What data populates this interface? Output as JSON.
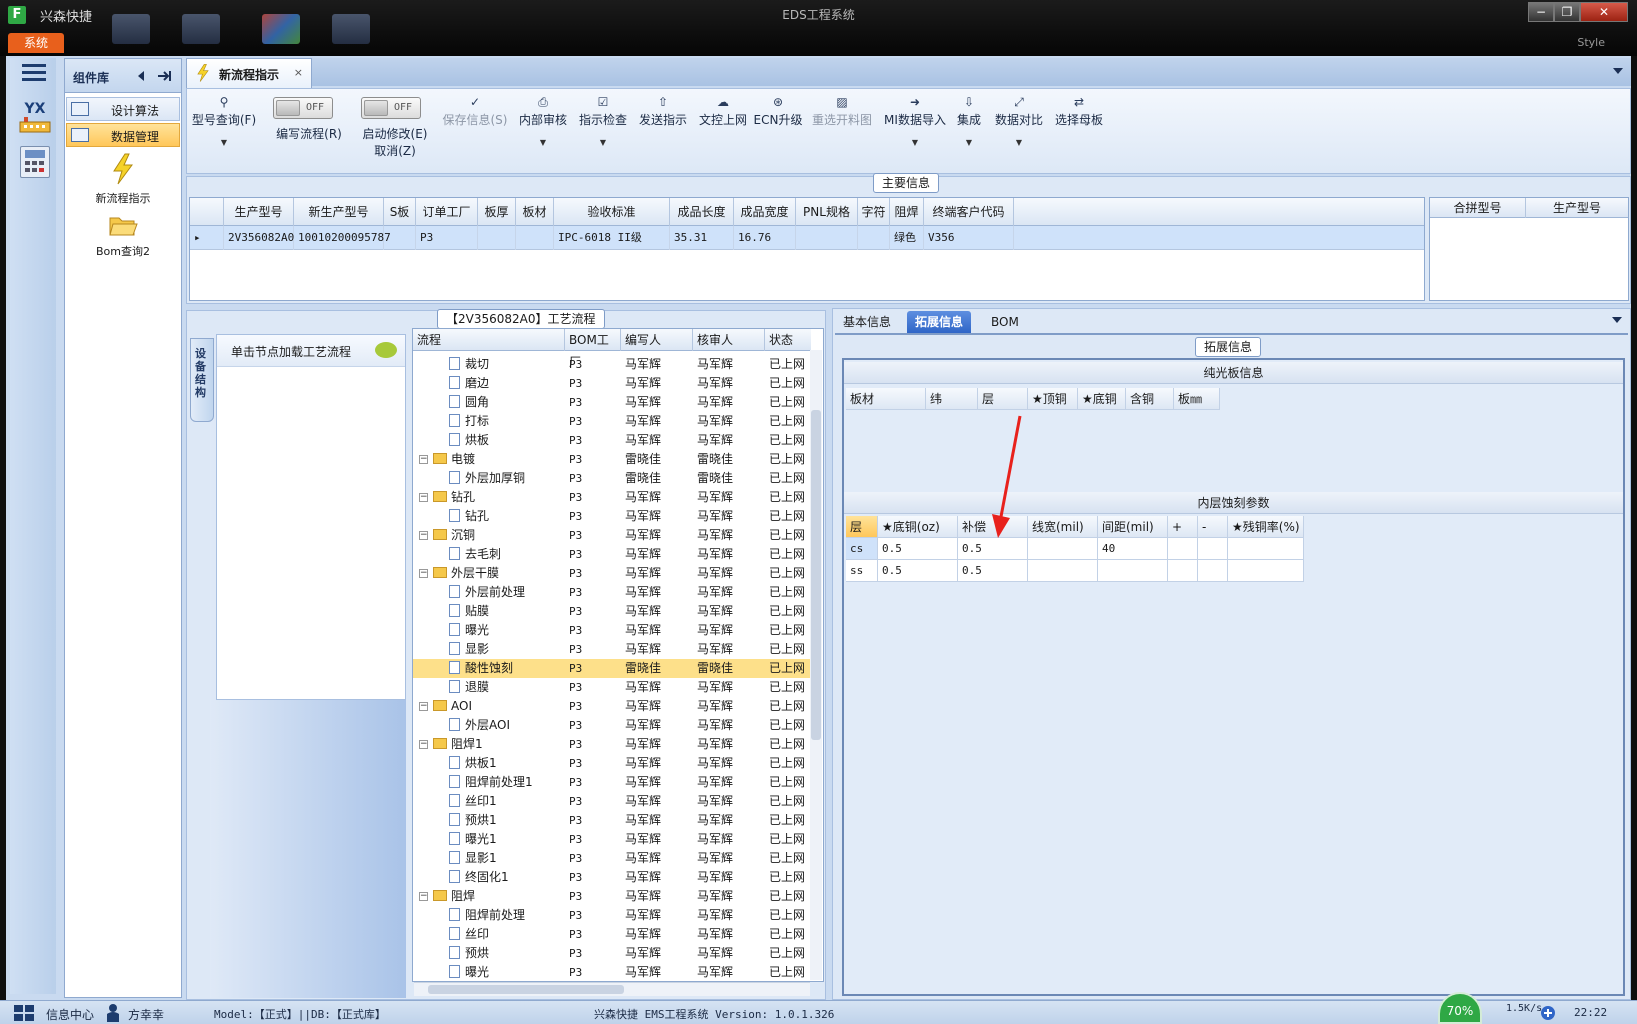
{
  "app": {
    "name": "兴森快捷",
    "window_title": "EDS工程系统",
    "system_menu": "系统",
    "style_label": "Style"
  },
  "window_buttons": {
    "minimize": "−",
    "restore": "❐",
    "close": "✕"
  },
  "library": {
    "title": "组件库",
    "items": [
      {
        "label": "设计算法",
        "selected": false
      },
      {
        "label": "数据管理",
        "selected": true
      }
    ],
    "big_items": [
      {
        "label": "新流程指示"
      },
      {
        "label": "Bom查询2"
      }
    ]
  },
  "doc_tab": {
    "label": "新流程指示",
    "close": "×"
  },
  "ribbon": {
    "buttons": [
      {
        "label": "型号查询(F)",
        "icon": "search-icon",
        "enabled": true
      },
      {
        "label": "编写流程(R)",
        "toggle": "OFF"
      },
      {
        "label": "启动修改(E)",
        "sub": "取消(Z)",
        "toggle": "OFF"
      },
      {
        "label": "保存信息(S)",
        "icon": "check-icon",
        "enabled": false
      },
      {
        "label": "内部审核",
        "icon": "printer-icon",
        "enabled": true
      },
      {
        "label": "指示检查",
        "icon": "checkbox-icon",
        "enabled": true
      },
      {
        "label": "发送指示",
        "icon": "upload-icon",
        "enabled": true
      },
      {
        "label": "文控上网",
        "icon": "cloud-upload-icon",
        "enabled": true
      },
      {
        "label": "ECN升级",
        "icon": "binoculars-icon",
        "enabled": true
      },
      {
        "label": "重选开料图",
        "icon": "image-icon",
        "enabled": false
      },
      {
        "label": "MI数据导入",
        "icon": "import-icon",
        "enabled": true
      },
      {
        "label": "集成",
        "icon": "download-icon",
        "enabled": true
      },
      {
        "label": "数据对比",
        "icon": "compare-icon",
        "enabled": true
      },
      {
        "label": "选择母板",
        "icon": "shuffle-icon",
        "enabled": true
      }
    ]
  },
  "main_info": {
    "title": "主要信息",
    "columns": [
      "生产型号",
      "新生产型号",
      "S板",
      "订单工厂",
      "板厚",
      "板材",
      "验收标准",
      "成品长度",
      "成品宽度",
      "PNL规格",
      "字符",
      "阻焊",
      "终端客户代码"
    ],
    "row": [
      "2V356082A0",
      "10010200095787",
      "",
      "P3",
      "",
      "",
      "IPC-6018 II级",
      "35.31",
      "16.76",
      "",
      "",
      "绿色",
      "V356"
    ],
    "side_columns": [
      "合拼型号",
      "生产型号"
    ]
  },
  "process": {
    "title": "【2V356082A0】工艺流程",
    "side_tab": "设备结构",
    "node_hint": "单击节点加载工艺流程",
    "columns": [
      "流程",
      "BOM工厂",
      "编写人",
      "核审人",
      "状态"
    ],
    "rows": [
      {
        "name": "裁切",
        "level": 2,
        "factory": "P3",
        "writer": "马军辉",
        "reviewer": "马军辉",
        "status": "已上网"
      },
      {
        "name": "磨边",
        "level": 2,
        "factory": "P3",
        "writer": "马军辉",
        "reviewer": "马军辉",
        "status": "已上网"
      },
      {
        "name": "圆角",
        "level": 2,
        "factory": "P3",
        "writer": "马军辉",
        "reviewer": "马军辉",
        "status": "已上网"
      },
      {
        "name": "打标",
        "level": 2,
        "factory": "P3",
        "writer": "马军辉",
        "reviewer": "马军辉",
        "status": "已上网"
      },
      {
        "name": "烘板",
        "level": 2,
        "factory": "P3",
        "writer": "马军辉",
        "reviewer": "马军辉",
        "status": "已上网"
      },
      {
        "name": "电镀",
        "level": 1,
        "factory": "P3",
        "writer": "雷晓佳",
        "reviewer": "雷晓佳",
        "status": "已上网"
      },
      {
        "name": "外层加厚铜",
        "level": 2,
        "factory": "P3",
        "writer": "雷晓佳",
        "reviewer": "雷晓佳",
        "status": "已上网"
      },
      {
        "name": "钻孔",
        "level": 1,
        "factory": "P3",
        "writer": "马军辉",
        "reviewer": "马军辉",
        "status": "已上网"
      },
      {
        "name": "钻孔",
        "level": 2,
        "factory": "P3",
        "writer": "马军辉",
        "reviewer": "马军辉",
        "status": "已上网"
      },
      {
        "name": "沉铜",
        "level": 1,
        "factory": "P3",
        "writer": "马军辉",
        "reviewer": "马军辉",
        "status": "已上网"
      },
      {
        "name": "去毛刺",
        "level": 2,
        "factory": "P3",
        "writer": "马军辉",
        "reviewer": "马军辉",
        "status": "已上网"
      },
      {
        "name": "外层干膜",
        "level": 1,
        "factory": "P3",
        "writer": "马军辉",
        "reviewer": "马军辉",
        "status": "已上网"
      },
      {
        "name": "外层前处理",
        "level": 2,
        "factory": "P3",
        "writer": "马军辉",
        "reviewer": "马军辉",
        "status": "已上网"
      },
      {
        "name": "贴膜",
        "level": 2,
        "factory": "P3",
        "writer": "马军辉",
        "reviewer": "马军辉",
        "status": "已上网"
      },
      {
        "name": "曝光",
        "level": 2,
        "factory": "P3",
        "writer": "马军辉",
        "reviewer": "马军辉",
        "status": "已上网"
      },
      {
        "name": "显影",
        "level": 2,
        "factory": "P3",
        "writer": "马军辉",
        "reviewer": "马军辉",
        "status": "已上网"
      },
      {
        "name": "酸性蚀刻",
        "level": 2,
        "factory": "P3",
        "writer": "雷晓佳",
        "reviewer": "雷晓佳",
        "status": "已上网",
        "selected": true
      },
      {
        "name": "退膜",
        "level": 2,
        "factory": "P3",
        "writer": "马军辉",
        "reviewer": "马军辉",
        "status": "已上网"
      },
      {
        "name": "AOI",
        "level": 1,
        "factory": "P3",
        "writer": "马军辉",
        "reviewer": "马军辉",
        "status": "已上网"
      },
      {
        "name": "外层AOI",
        "level": 2,
        "factory": "P3",
        "writer": "马军辉",
        "reviewer": "马军辉",
        "status": "已上网"
      },
      {
        "name": "阻焊1",
        "level": 1,
        "factory": "P3",
        "writer": "马军辉",
        "reviewer": "马军辉",
        "status": "已上网"
      },
      {
        "name": "烘板1",
        "level": 2,
        "factory": "P3",
        "writer": "马军辉",
        "reviewer": "马军辉",
        "status": "已上网"
      },
      {
        "name": "阻焊前处理1",
        "level": 2,
        "factory": "P3",
        "writer": "马军辉",
        "reviewer": "马军辉",
        "status": "已上网"
      },
      {
        "name": "丝印1",
        "level": 2,
        "factory": "P3",
        "writer": "马军辉",
        "reviewer": "马军辉",
        "status": "已上网"
      },
      {
        "name": "预烘1",
        "level": 2,
        "factory": "P3",
        "writer": "马军辉",
        "reviewer": "马军辉",
        "status": "已上网"
      },
      {
        "name": "曝光1",
        "level": 2,
        "factory": "P3",
        "writer": "马军辉",
        "reviewer": "马军辉",
        "status": "已上网"
      },
      {
        "name": "显影1",
        "level": 2,
        "factory": "P3",
        "writer": "马军辉",
        "reviewer": "马军辉",
        "status": "已上网"
      },
      {
        "name": "终固化1",
        "level": 2,
        "factory": "P3",
        "writer": "马军辉",
        "reviewer": "马军辉",
        "status": "已上网"
      },
      {
        "name": "阻焊",
        "level": 1,
        "factory": "P3",
        "writer": "马军辉",
        "reviewer": "马军辉",
        "status": "已上网"
      },
      {
        "name": "阻焊前处理",
        "level": 2,
        "factory": "P3",
        "writer": "马军辉",
        "reviewer": "马军辉",
        "status": "已上网"
      },
      {
        "name": "丝印",
        "level": 2,
        "factory": "P3",
        "writer": "马军辉",
        "reviewer": "马军辉",
        "status": "已上网"
      },
      {
        "name": "预烘",
        "level": 2,
        "factory": "P3",
        "writer": "马军辉",
        "reviewer": "马军辉",
        "status": "已上网"
      },
      {
        "name": "曝光",
        "level": 2,
        "factory": "P3",
        "writer": "马军辉",
        "reviewer": "马军辉",
        "status": "已上网"
      }
    ]
  },
  "right": {
    "tabs": [
      {
        "label": "基本信息"
      },
      {
        "label": "拓展信息",
        "selected": true
      },
      {
        "label": "BOM"
      }
    ],
    "group_title": "拓展信息",
    "bare_board": {
      "title": "纯光板信息",
      "columns": [
        "板材",
        "纬",
        "层",
        "★顶铜",
        "★底铜",
        "含铜",
        "板㎜"
      ]
    },
    "inner_etch": {
      "title": "内层蚀刻参数",
      "columns": [
        "层",
        "★底铜(oz)",
        "补偿",
        "线宽(mil)",
        "间距(mil)",
        "+",
        "-",
        "★残铜率(%)"
      ],
      "rows": [
        [
          "cs",
          "0.5",
          "0.5",
          "",
          "40",
          "",
          "",
          ""
        ],
        [
          "ss",
          "0.5",
          "0.5",
          "",
          "",
          "",
          "",
          ""
        ]
      ]
    }
  },
  "status": {
    "info_center": "信息中心",
    "user": "方幸幸",
    "model_db": "Model:【正式】||DB:【正式库】",
    "version": "兴森快捷 EMS工程系统 Version: 1.0.1.326",
    "gauge": "70%",
    "net_up": "1.5K/s",
    "clock": "22:22"
  }
}
